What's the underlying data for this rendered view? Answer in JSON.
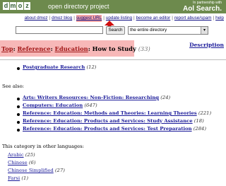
{
  "header": {
    "logo_letters": [
      "d",
      "m",
      "o",
      "z"
    ],
    "tagline": "open directory project",
    "partner_small": "In partnership with",
    "partner_brand": "Aol Search."
  },
  "nav": [
    {
      "label": "about dmoz"
    },
    {
      "label": "dmoz blog"
    },
    {
      "label": "suggest URL"
    },
    {
      "label": "update listing"
    },
    {
      "label": "become an editor"
    },
    {
      "label": "report abuse/spam"
    },
    {
      "label": "help"
    }
  ],
  "search": {
    "value": "",
    "button_label": "Search",
    "scope": "the entire directory"
  },
  "breadcrumb": {
    "top": "Top",
    "reference": "Reference",
    "education": "Education",
    "current": "How to Study",
    "count": "(33)",
    "sep": ":"
  },
  "description_link": "Description",
  "subcategories": [
    {
      "label": "Postgraduate Research",
      "count": "(12)"
    }
  ],
  "see_also_label": "See also:",
  "see_also": [
    {
      "label": "Arts: Writers Resources: Non-Fiction: Researching",
      "count": "(24)"
    },
    {
      "label": "Computers: Education",
      "count": "(647)"
    },
    {
      "label": "Reference: Education: Methods and Theories: Learning Theories",
      "count": "(221)"
    },
    {
      "label": "Reference: Education: Products and Services: Study Assistance",
      "count": "(18)"
    },
    {
      "label": "Reference: Education: Products and Services: Test Preparation",
      "count": "(284)"
    }
  ],
  "languages_label": "This category in other languages:",
  "languages": [
    {
      "label": "Arabic",
      "count": "(25)"
    },
    {
      "label": "Chinese",
      "count": "(6)"
    },
    {
      "label": "Chinese Simplified",
      "count": "(27)"
    },
    {
      "label": "Farsi",
      "count": "(1)"
    }
  ],
  "colors": {
    "banner": "#6d8a4d",
    "highlight": "#f7b8b8",
    "link": "#1a1a99",
    "annotation_arrow": "#d01010"
  }
}
